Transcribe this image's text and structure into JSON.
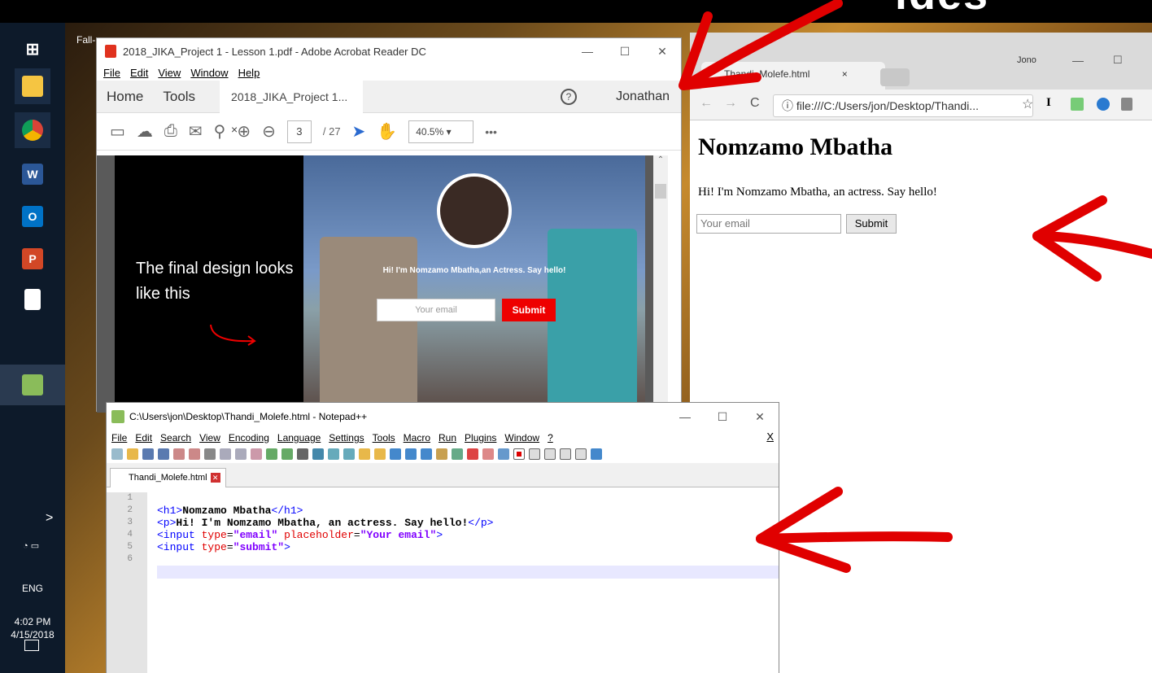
{
  "caption": "ides",
  "desktop_label": "Fall-",
  "taskbar": {
    "language": "ENG",
    "time": "4:02 PM",
    "date": "4/15/2018",
    "chevron": ">"
  },
  "acrobat": {
    "title": "2018_JIKA_Project 1 - Lesson 1.pdf - Adobe Acrobat Reader DC",
    "menu": [
      "File",
      "Edit",
      "View",
      "Window",
      "Help"
    ],
    "tabs": {
      "home": "Home",
      "tools": "Tools",
      "doc_tab": "2018_JIKA_Project 1... ×",
      "user": "Jonathan",
      "help": "?"
    },
    "page_current": "3",
    "page_total": "/ 27",
    "zoom": "40.5%",
    "more": "•••",
    "pdf": {
      "headline": "The final design looks like this",
      "tagline": "Hi! I'm Nomzamo Mbatha,an Actress. Say hello!",
      "input_placeholder": "Your email",
      "submit": "Submit"
    }
  },
  "chrome": {
    "tab_title": "Thandi_Molefe.html",
    "tab_close": "×",
    "user": "Jono",
    "url": "file:///C:/Users/jon/Desktop/Thandi...",
    "page": {
      "h1": "Nomzamo Mbatha",
      "p": "Hi! I'm Nomzamo Mbatha, an actress. Say hello!",
      "input_placeholder": "Your email",
      "submit": "Submit"
    }
  },
  "notepadpp": {
    "title": "C:\\Users\\jon\\Desktop\\Thandi_Molefe.html - Notepad++",
    "menu": [
      "File",
      "Edit",
      "Search",
      "View",
      "Encoding",
      "Language",
      "Settings",
      "Tools",
      "Macro",
      "Run",
      "Plugins",
      "Window",
      "?"
    ],
    "close_x": "X",
    "tab": "Thandi_Molefe.html",
    "line_numbers": [
      "1",
      "2",
      "3",
      "4",
      "5",
      "6"
    ]
  }
}
